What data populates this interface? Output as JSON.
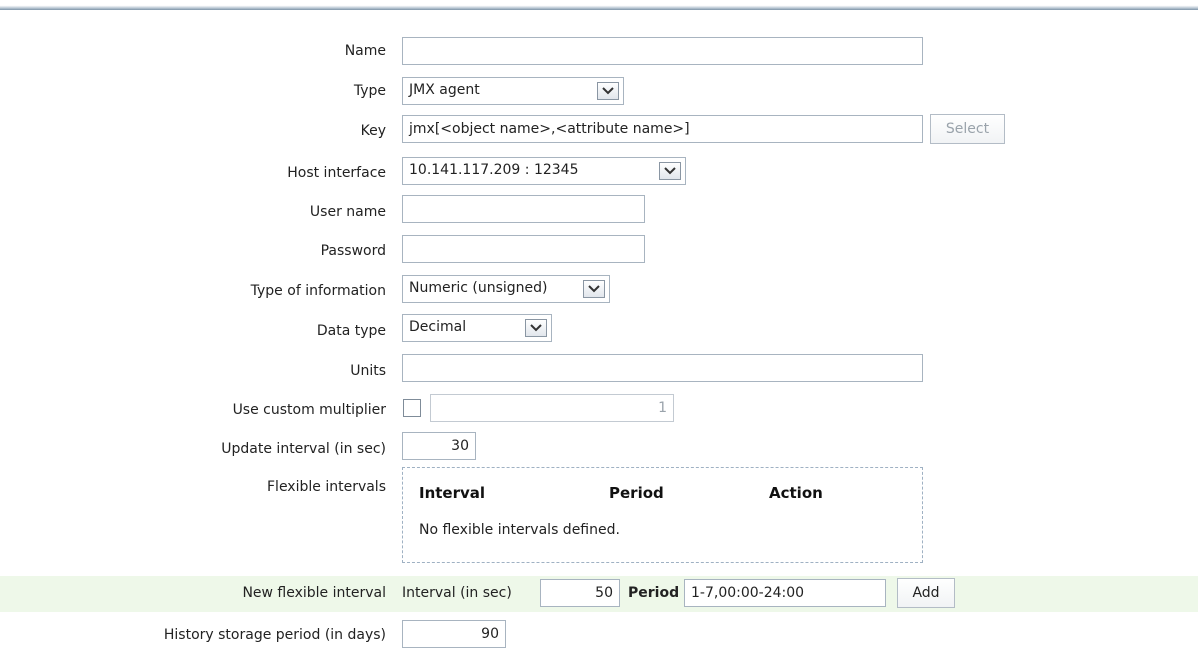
{
  "form": {
    "name": {
      "label": "Name",
      "value": ""
    },
    "type": {
      "label": "Type",
      "value": "JMX agent"
    },
    "key": {
      "label": "Key",
      "value": "jmx[<object name>,<attribute name>]",
      "button": "Select"
    },
    "host_interface": {
      "label": "Host interface",
      "value": "10.141.117.209 : 12345"
    },
    "user_name": {
      "label": "User name",
      "value": ""
    },
    "password": {
      "label": "Password",
      "value": ""
    },
    "type_of_information": {
      "label": "Type of information",
      "value": "Numeric (unsigned)"
    },
    "data_type": {
      "label": "Data type",
      "value": "Decimal"
    },
    "units": {
      "label": "Units",
      "value": ""
    },
    "custom_multiplier": {
      "label": "Use custom multiplier",
      "checked": false,
      "value": "1"
    },
    "update_interval": {
      "label": "Update interval (in sec)",
      "value": "30"
    },
    "flexible_intervals": {
      "label": "Flexible intervals",
      "columns": [
        "Interval",
        "Period",
        "Action"
      ],
      "empty_text": "No flexible intervals defined."
    },
    "new_flexible_interval": {
      "label": "New flexible interval",
      "interval_label": "Interval (in sec)",
      "interval_value": "50",
      "period_label": "Period",
      "period_value": "1-7,00:00-24:00",
      "add_button": "Add"
    },
    "history": {
      "label": "History storage period (in days)",
      "value": "90"
    }
  },
  "colors": {
    "highlight_row": "#eef8e9",
    "field_border": "#a8b4c0"
  },
  "icons": {
    "dropdown": "chevron-down-icon"
  }
}
